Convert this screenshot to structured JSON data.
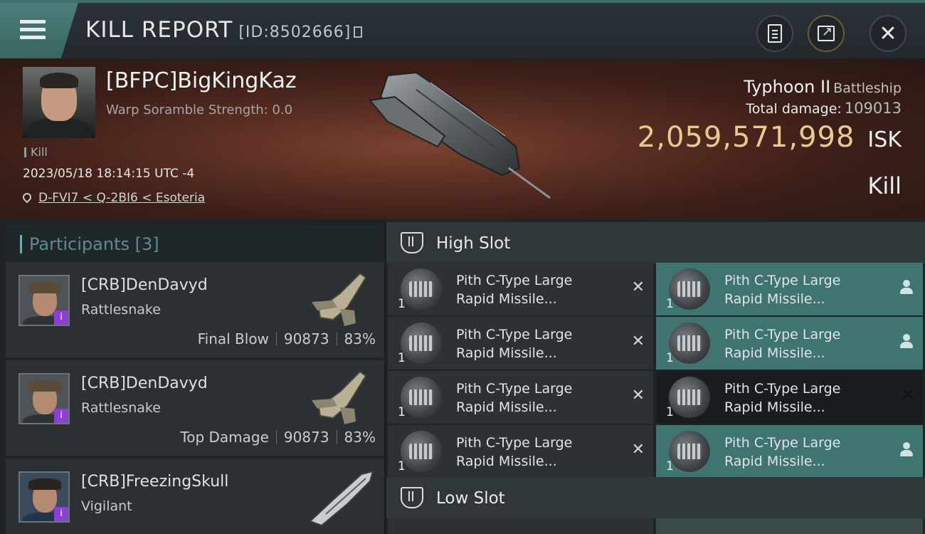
{
  "header": {
    "title": "KILL REPORT",
    "report_id": "[ID:8502666]"
  },
  "victim": {
    "name": "[BFPC]BigKingKaz",
    "warp_scramble": "Warp Soramble Strength: 0.0",
    "tag": "Kill",
    "datetime": "2023/05/18 18:14:15 UTC -4",
    "location": "D-FVI7 < Q-2BI6 < Esoteria",
    "ship_name": "Typhoon II",
    "ship_class": "Battleship",
    "total_damage_label": "Total damage:",
    "total_damage": "109013",
    "isk_value": "2,059,571,998",
    "isk_unit": "ISK",
    "outcome": "Kill"
  },
  "participants": {
    "header": "Participants [3]",
    "rows": [
      {
        "name": "[CRB]DenDavyd",
        "ship": "Rattlesnake",
        "role": "Final Blow",
        "damage": "90873",
        "percent": "83%"
      },
      {
        "name": "[CRB]DenDavyd",
        "ship": "Rattlesnake",
        "role": "Top Damage",
        "damage": "90873",
        "percent": "83%"
      },
      {
        "name": "[CRB]FreezingSkull",
        "ship": "Vigilant",
        "role": "",
        "damage": "",
        "percent": ""
      }
    ],
    "badge_glyph": "i"
  },
  "fitting": {
    "high_slot_label": "High Slot",
    "low_slot_label": "Low Slot",
    "destroyed_glyph": "✕",
    "modules": [
      {
        "line1": "Pith C-Type Large",
        "line2": "Rapid Missile...",
        "qty": "1",
        "state": "destroyed"
      },
      {
        "line1": "Pith C-Type Large",
        "line2": "Rapid Missile...",
        "qty": "1",
        "state": "dropped"
      },
      {
        "line1": "Pith C-Type Large",
        "line2": "Rapid Missile...",
        "qty": "1",
        "state": "destroyed"
      },
      {
        "line1": "Pith C-Type Large",
        "line2": "Rapid Missile...",
        "qty": "1",
        "state": "dropped"
      },
      {
        "line1": "Pith C-Type Large",
        "line2": "Rapid Missile...",
        "qty": "1",
        "state": "destroyed"
      },
      {
        "line1": "Pith C-Type Large",
        "line2": "Rapid Missile...",
        "qty": "1",
        "state": "destroyed"
      },
      {
        "line1": "Pith C-Type Large",
        "line2": "Rapid Missile...",
        "qty": "1",
        "state": "destroyed"
      },
      {
        "line1": "Pith C-Type Large",
        "line2": "Rapid Missile...",
        "qty": "1",
        "state": "dropped"
      }
    ]
  },
  "icons": {
    "menu": "hamburger-icon",
    "copy": "copy-icon",
    "clipboard": "clipboard-icon",
    "share": "share-icon",
    "close": "close-icon",
    "location": "location-pin-icon",
    "slot": "slot-icon",
    "dropped": "person-icon"
  },
  "colors": {
    "accent_teal": "#41706c",
    "isk_gold": "#e8c98f",
    "fitted_row": "#3f7471",
    "badge_purple": "#8b3fd6"
  }
}
